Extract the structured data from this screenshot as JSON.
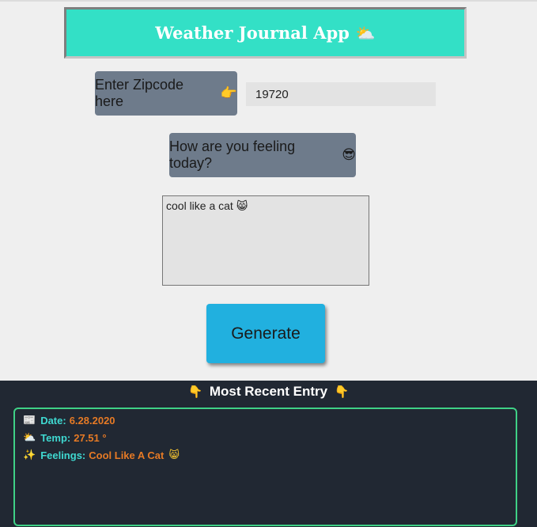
{
  "header": {
    "title": "Weather Journal App",
    "emoji": "⛅"
  },
  "zip": {
    "label": "Enter Zipcode here",
    "emoji": "👉",
    "value": "19720"
  },
  "feelings": {
    "label": "How are you feeling today?",
    "emoji": "😎",
    "text": "cool like a cat",
    "text_emoji": "😸"
  },
  "generate": {
    "label": "Generate"
  },
  "recent": {
    "title": "Most Recent Entry",
    "title_emoji": "👇",
    "date": {
      "icon": "📰",
      "label": "Date:",
      "value": "6.28.2020"
    },
    "temp": {
      "icon": "⛅",
      "label": "Temp:",
      "value": "27.51 °"
    },
    "feel": {
      "icon": "✨",
      "label": "Feelings:",
      "value": "Cool Like A Cat",
      "emoji": "😸"
    }
  },
  "colors": {
    "header_bg": "#33e0c6",
    "label_bg": "#6e7b8b",
    "button_bg": "#21b0df",
    "panel_bg": "#212833",
    "entry_border": "#3fd186",
    "entry_key": "#3fd9d1",
    "entry_value": "#e67a25"
  }
}
